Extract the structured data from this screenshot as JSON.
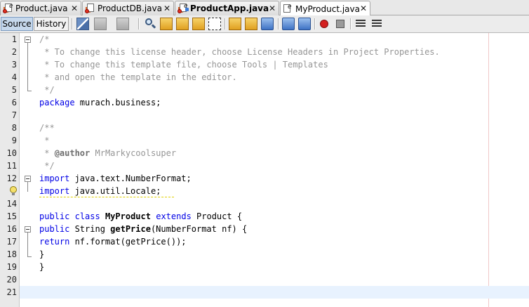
{
  "tabs": [
    {
      "label": "Product.java",
      "close": "✕"
    },
    {
      "label": "ProductDB.java",
      "close": "✕"
    },
    {
      "label": "ProductApp.java",
      "close": "✕"
    },
    {
      "label": "MyProduct.java",
      "close": "✕"
    }
  ],
  "toolbar": {
    "source_label": "Source",
    "history_label": "History"
  },
  "editor": {
    "line_numbers": [
      "1",
      "2",
      "3",
      "4",
      "5",
      "6",
      "7",
      "8",
      "9",
      "10",
      "11",
      "12",
      "13",
      "14",
      "15",
      "16",
      "17",
      "18",
      "19",
      "20",
      "21"
    ]
  },
  "code": {
    "l1": "/*",
    "l2": " * To change this license header, choose License Headers in Project Properties.",
    "l3": " * To change this template file, choose Tools | Templates",
    "l4": " * and open the template in the editor.",
    "l5": " */",
    "l6_kw": "package",
    "l6_rest": " murach.business;",
    "l8": "/**",
    "l9": " *",
    "l10_pre": " * ",
    "l10_tag": "@author",
    "l10_rest": " MrMarkycoolsuper",
    "l11": " */",
    "l12_kw": "import",
    "l12_rest": " java.text.NumberFormat;",
    "l13_kw": "import",
    "l13_rest": " java.util.Locale;",
    "l15_kw1": "public",
    "l15_kw2": "class",
    "l15_name": "MyProduct",
    "l15_kw3": "extends",
    "l15_rest": " Product {",
    "l16_kw": "public",
    "l16_type": " String ",
    "l16_name": "getPrice",
    "l16_rest": "(NumberFormat nf) {",
    "l17_kw": "return",
    "l17_rest": " nf.format(getPrice());",
    "l18": "}",
    "l19": "}"
  }
}
